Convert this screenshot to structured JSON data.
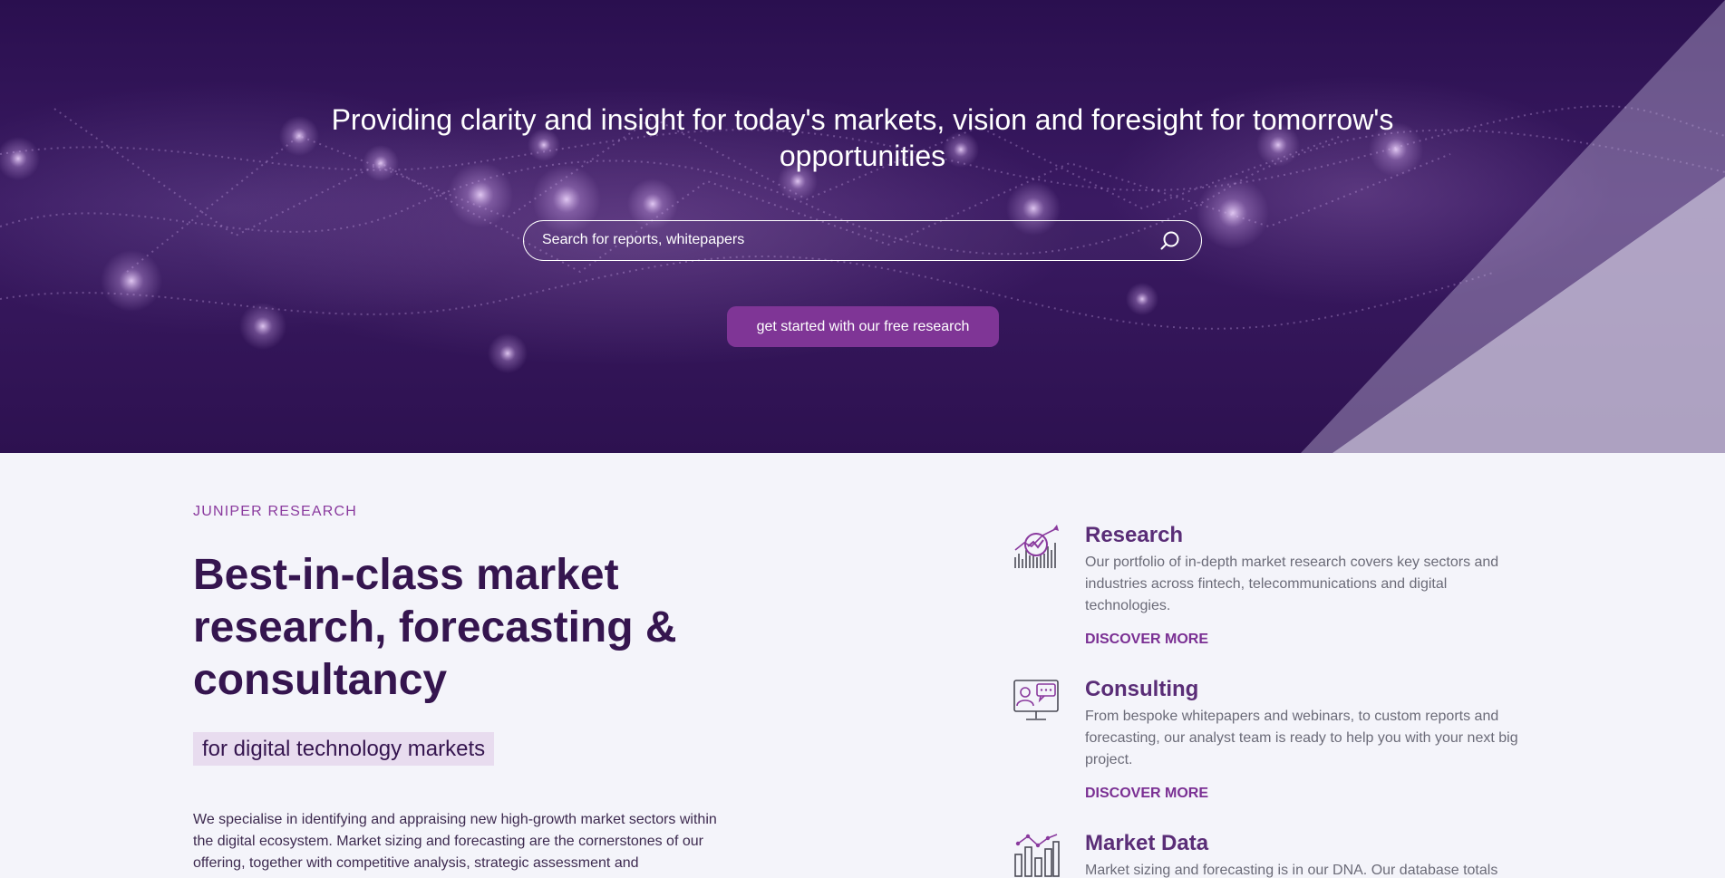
{
  "hero": {
    "title": "Providing clarity and insight for today's markets, vision and foresight for tomorrow's opportunities",
    "search": {
      "placeholder": "Search for reports, whitepapers",
      "value": "",
      "icon": "search-icon"
    },
    "cta_label": "get started with our free research",
    "colors": {
      "background": "#2a0f4f",
      "cta": "#7f3596"
    }
  },
  "about": {
    "eyebrow": "JUNIPER RESEARCH",
    "headline": "Best-in-class market research, forecasting & consultancy",
    "tag": "for digital technology markets",
    "intro": "We specialise in identifying and appraising new high-growth market sectors within the digital ecosystem. Market sizing and forecasting are the cornerstones of our offering, together with competitive analysis, strategic assessment and"
  },
  "services": [
    {
      "title": "Research",
      "description": "Our portfolio of in-depth market research covers key sectors and industries across fintech, telecommunications and digital technologies.",
      "link": "DISCOVER MORE",
      "icon": "research-chart-icon"
    },
    {
      "title": "Consulting",
      "description": "From bespoke whitepapers and webinars, to custom reports and forecasting, our analyst team is ready to help you with your next big project.",
      "link": "DISCOVER MORE",
      "icon": "consulting-monitor-icon"
    },
    {
      "title": "Market Data",
      "description": "Market sizing and forecasting is in our DNA. Our database totals over",
      "icon": "market-data-bars-icon"
    }
  ],
  "colors": {
    "accent": "#7a2f93",
    "heading": "#35154f",
    "page_background": "#f4f4fa"
  }
}
